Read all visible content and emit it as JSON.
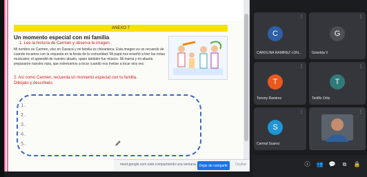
{
  "document": {
    "annex_label": "ANEXO 7",
    "title": "Un momento especial con mi familia",
    "step1": "1. Lee la historia de Carmen y observa la imagen.",
    "paragraph": "Mi nombre es Carmen, vivo en Oaxaca y mi familia es chinanteca. Esta imagen es un recuerdo de cuando tocamos con la orquesta en la fiesta de la comunidad. Mi papá nos enseñó a leer las notas musicales; él aprendió de nuestro abuelo, quien también fue músico. Mi mamá y mi abuela prepararon nuestra ropa, que estrenamos a tocar cuando nos invitan a tocar otra vez.",
    "step2": "2. Así como Carmen, recuerda un momento especial con tu familia.",
    "step3": "Dibújalo y descríbelo.",
    "numbers": [
      "1.",
      "2.",
      "3.",
      "4.",
      "5."
    ]
  },
  "share_bar": {
    "text": "meet.google.com está compartiendo una ventana.",
    "stop_label": "Dejar de compartir",
    "hide_label": "Ocultar"
  },
  "participants": [
    {
      "initial": "C",
      "name": "CAROLINA RAMIREZ LON...",
      "color": "#2f5fa8"
    },
    {
      "initial": "G",
      "name": "Griselda V",
      "color": "#4b5056"
    },
    {
      "initial": "T",
      "name": "Tommy Ramirez",
      "color": "#e9591d"
    },
    {
      "initial": "T",
      "name": "Teófilo Ortiz",
      "color": "#2f7b7a"
    },
    {
      "initial": "S",
      "name": "Carmal Suarez",
      "color": "#1e96d6"
    }
  ],
  "colors": {
    "accent": "#1a73e8",
    "annex_yellow": "#f6e200",
    "dashed_blue": "#3c67b7"
  }
}
